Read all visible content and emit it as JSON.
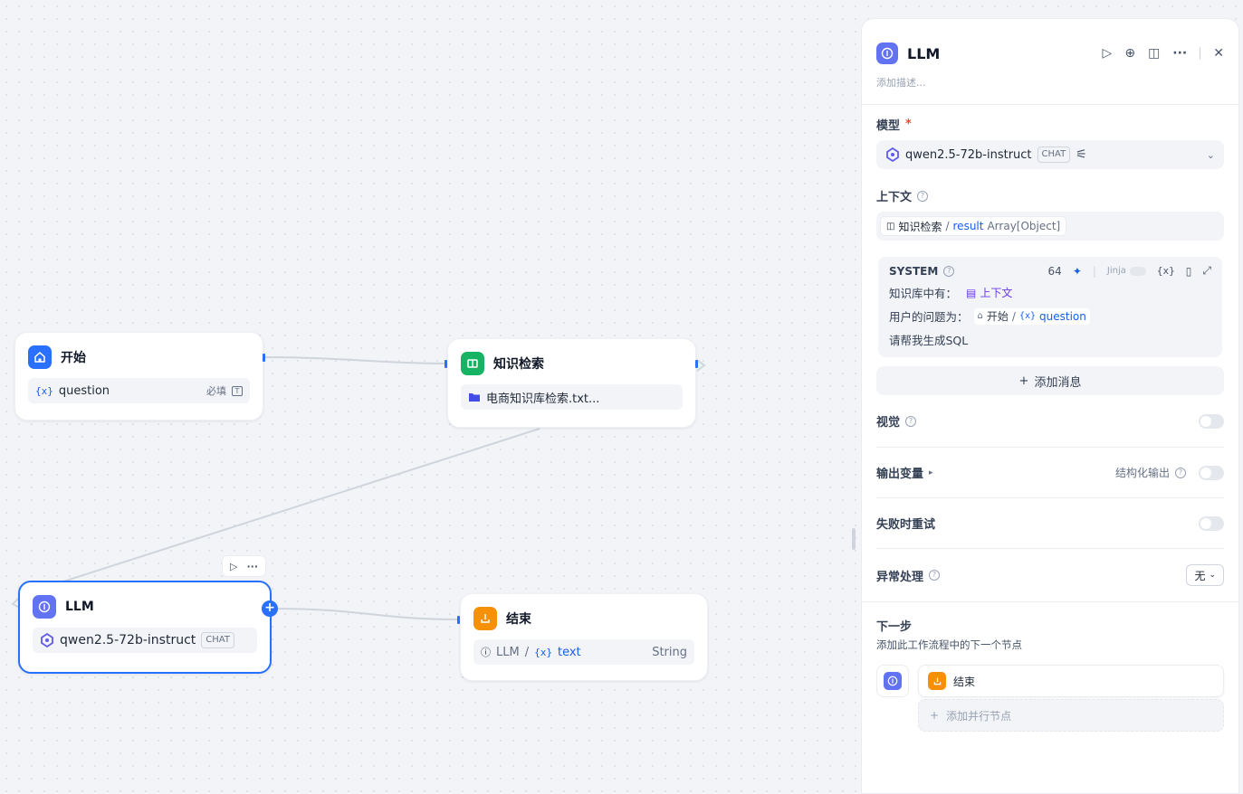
{
  "nodes": {
    "start": {
      "title": "开始",
      "var_icon": "{x}",
      "var_name": "question",
      "required": "必填"
    },
    "knowledge": {
      "title": "知识检索",
      "dataset": "电商知识库检索.txt..."
    },
    "llm": {
      "title": "LLM",
      "model": "qwen2.5-72b-instruct",
      "model_tag": "CHAT"
    },
    "end": {
      "title": "结束",
      "src_node": "LLM",
      "sep": "/",
      "var_icon": "{x}",
      "var_name": "text",
      "type": "String"
    }
  },
  "panel": {
    "title": "LLM",
    "description_placeholder": "添加描述...",
    "model": {
      "label": "模型",
      "required_mark": "*",
      "name": "qwen2.5-72b-instruct",
      "tag": "CHAT"
    },
    "context": {
      "label": "上下文",
      "node": "知识检索",
      "sep": "/",
      "var": "result",
      "type": "Array[Object]"
    },
    "system": {
      "title": "SYSTEM",
      "count": "64",
      "jinja": "Jinja",
      "var_btn": "{x}",
      "line1_prefix": "知识库中有：",
      "line1_chip": "上下文",
      "line2_prefix": "用户的问题为：",
      "line2_node": "开始",
      "line2_sep": "/",
      "line2_var_icon": "{x}",
      "line2_var": "question",
      "line3": "请帮我生成SQL"
    },
    "add_message": "添加消息",
    "vision": {
      "label": "视觉"
    },
    "output": {
      "label": "输出变量",
      "structured": "结构化输出"
    },
    "retry": {
      "label": "失败时重试"
    },
    "error": {
      "label": "异常处理",
      "value": "无"
    },
    "next": {
      "label": "下一步",
      "desc": "添加此工作流程中的下一个节点",
      "item": "结束",
      "add_parallel": "添加并行节点"
    }
  },
  "colors": {
    "accent": "#2970ff",
    "start_icon": "#2970ff",
    "knowledge_icon": "#16b364",
    "llm_icon": "#6172f3",
    "end_icon": "#f79009"
  }
}
